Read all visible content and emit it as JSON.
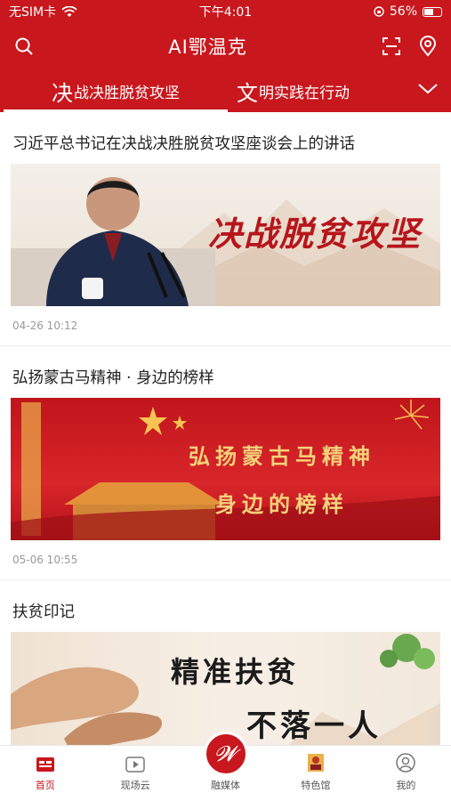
{
  "status_bar": {
    "carrier": "无SIM卡",
    "time": "下午4:01",
    "battery": "56%",
    "battery_level": 0.56
  },
  "header": {
    "title": "AI鄂温克"
  },
  "tabs": [
    {
      "first_char": "决",
      "rest": "战决胜脱贫攻坚"
    },
    {
      "first_char": "文",
      "rest": "明实践在行动"
    }
  ],
  "articles": [
    {
      "title": "习近平总书记在决战决胜脱贫攻坚座谈会上的讲话",
      "banner_text": "决战脱贫攻坚",
      "time": "04-26 10:12"
    },
    {
      "title": "弘扬蒙古马精神 · 身边的榜样",
      "banner_line1": "弘扬蒙古马精神",
      "banner_line2": "身边的榜样",
      "time": "05-06 10:55"
    },
    {
      "title": "扶贫印记",
      "banner_line1": "精准扶贫",
      "banner_line2": "不落一人"
    }
  ],
  "tabbar": {
    "items": [
      {
        "label": "首页"
      },
      {
        "label": "现场云"
      },
      {
        "label": "融媒体"
      },
      {
        "label": "特色馆"
      },
      {
        "label": "我的"
      }
    ]
  },
  "colors": {
    "brand": "#c8171d"
  },
  "icons": [
    "search-icon",
    "scan-icon",
    "location-icon",
    "chevron-down-icon",
    "wifi-icon"
  ]
}
